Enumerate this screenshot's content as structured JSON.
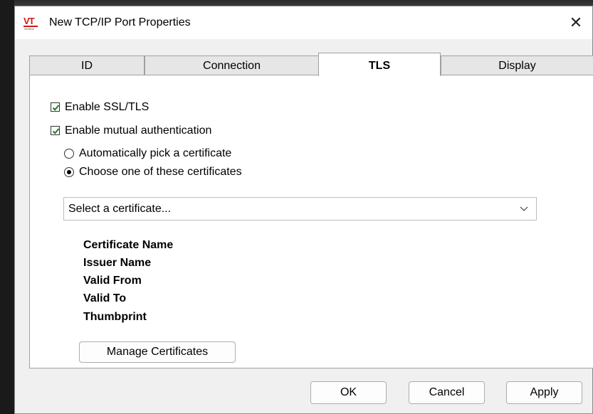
{
  "window": {
    "title": "New TCP/IP Port Properties",
    "app_icon": "vt-scada-logo-icon",
    "close_glyph": "✕"
  },
  "tabs": [
    {
      "label": "ID"
    },
    {
      "label": "Connection"
    },
    {
      "label": "TLS"
    },
    {
      "label": "Display"
    }
  ],
  "active_tab": "TLS",
  "tls": {
    "enable_ssl": {
      "label": "Enable SSL/TLS",
      "checked": true
    },
    "mutual_auth": {
      "label": "Enable mutual authentication",
      "checked": true
    },
    "radio_auto": {
      "label": "Automatically pick a certificate",
      "selected": false
    },
    "radio_choose": {
      "label": "Choose one of these certificates",
      "selected": true
    },
    "certificate_select": {
      "value": "Select a certificate..."
    },
    "info_labels": {
      "certificate_name": "Certificate Name",
      "issuer_name": "Issuer Name",
      "valid_from": "Valid From",
      "valid_to": "Valid To",
      "thumbprint": "Thumbprint"
    },
    "manage_button": "Manage Certificates"
  },
  "footer": {
    "ok": "OK",
    "cancel": "Cancel",
    "apply": "Apply"
  },
  "colors": {
    "dialog_bg": "#f0f0f0",
    "panel_bg": "#ffffff",
    "check_green": "#1e7e1e",
    "logo_red": "#d01818"
  }
}
